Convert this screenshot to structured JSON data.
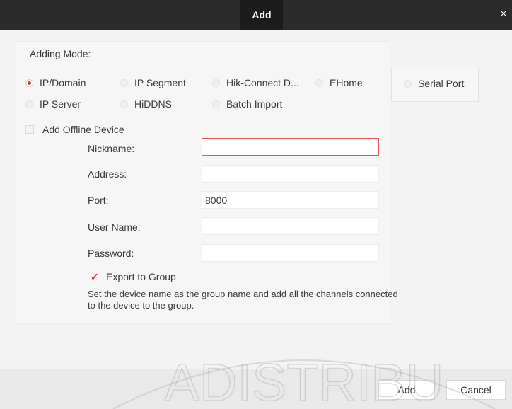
{
  "dialog": {
    "title": "Add",
    "close_glyph": "×"
  },
  "adding_mode": {
    "label": "Adding Mode:",
    "options": [
      {
        "label": "IP/Domain",
        "selected": true
      },
      {
        "label": "IP Segment",
        "selected": false
      },
      {
        "label": "Hik-Connect D...",
        "selected": false
      },
      {
        "label": "EHome",
        "selected": false
      },
      {
        "label": "Serial Port",
        "selected": false
      },
      {
        "label": "IP Server",
        "selected": false
      },
      {
        "label": "HiDDNS",
        "selected": false
      },
      {
        "label": "Batch Import",
        "selected": false
      }
    ]
  },
  "offline": {
    "label": "Add Offline Device",
    "checked": false
  },
  "form": {
    "nickname": {
      "label": "Nickname:",
      "value": ""
    },
    "address": {
      "label": "Address:",
      "value": ""
    },
    "port": {
      "label": "Port:",
      "value": "8000"
    },
    "username": {
      "label": "User Name:",
      "value": ""
    },
    "password": {
      "label": "Password:",
      "value": ""
    }
  },
  "export_group": {
    "label": "Export to Group",
    "checked": true,
    "hint": "Set the device name as the group name and add all the channels connected to the device to the group."
  },
  "footer": {
    "add_label": "Add",
    "cancel_label": "Cancel"
  },
  "watermark": {
    "text": "ADISTRIBU"
  },
  "colors": {
    "titlebar": "#2b2b2b",
    "accent_red": "#e03030",
    "focus_border": "#e05a5a"
  }
}
